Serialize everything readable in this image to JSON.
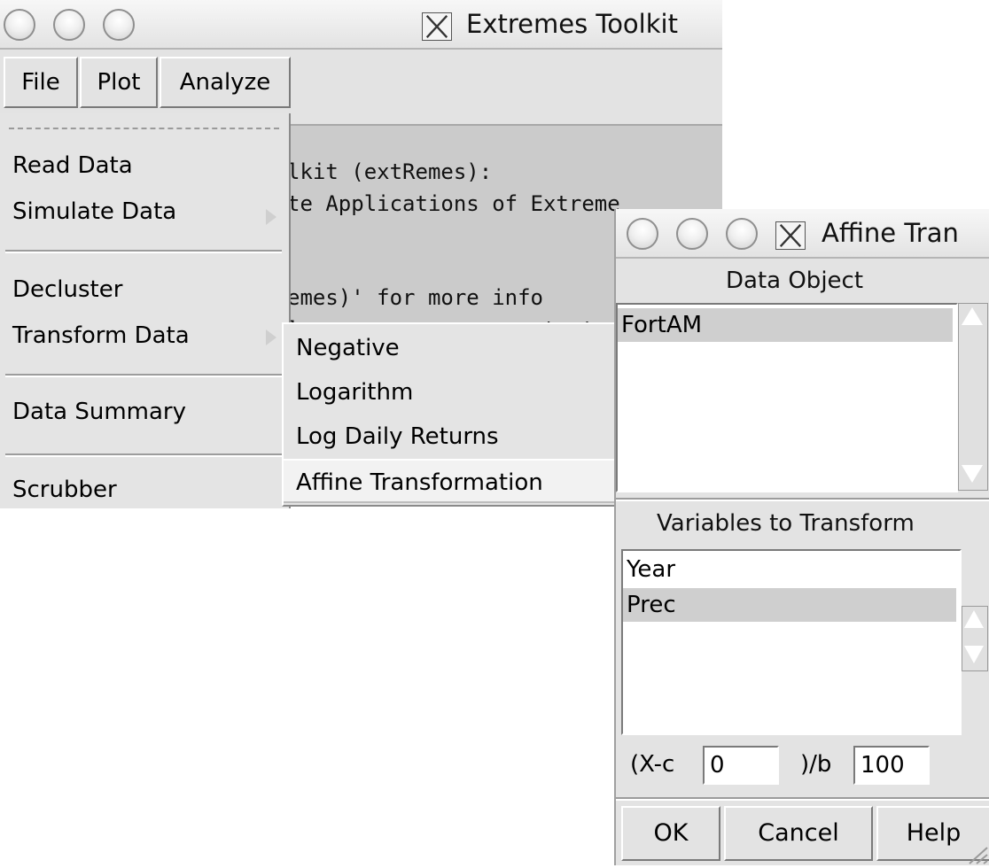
{
  "main_window": {
    "title": "Extremes Toolkit",
    "menubar": [
      "File",
      "Plot",
      "Analyze"
    ],
    "console_lines": [
      "lkit (extRemes):",
      "te Applications of Extreme",
      "emes)' for more info",
      "l                   t  t  i"
    ]
  },
  "file_menu": {
    "items": [
      "Read Data",
      "Simulate Data",
      "Decluster",
      "Transform Data",
      "Data Summary",
      "Scrubber"
    ]
  },
  "transform_submenu": {
    "items": [
      "Negative",
      "Logarithm",
      "Log Daily Returns",
      "Affine Transformation"
    ]
  },
  "affine_dialog": {
    "title": "Affine Tran",
    "data_object_label": "Data Object",
    "data_objects": [
      "FortAM"
    ],
    "variables_label": "Variables to Transform",
    "variables": [
      "Year",
      "Prec"
    ],
    "formula": {
      "prefix": "(X-c",
      "c_value": "0",
      "middle": ")/b",
      "b_value": "100"
    },
    "buttons": {
      "ok": "OK",
      "cancel": "Cancel",
      "help": "Help"
    }
  }
}
